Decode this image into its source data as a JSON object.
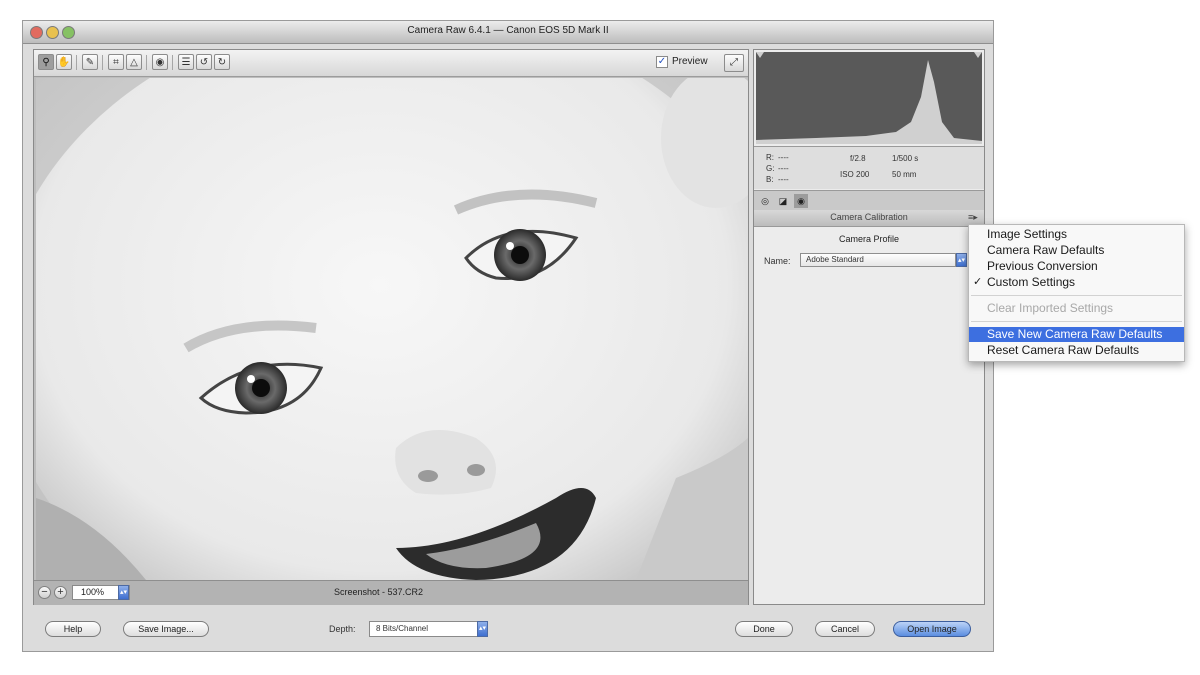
{
  "window": {
    "title": "Camera Raw 6.4.1  —  Canon EOS 5D Mark II"
  },
  "toolbar": {
    "tools": [
      "zoom-icon",
      "hand-icon",
      "eyedropper-icon",
      "crop-icon",
      "straighten-icon",
      "redeye-icon",
      "preferences-icon",
      "rotate-left-icon",
      "rotate-right-icon"
    ],
    "preview_label": "Preview",
    "preview_checked": "✓"
  },
  "status": {
    "zoom_value": "100%",
    "filename": "Screenshot - 537.CR2"
  },
  "exif": {
    "r_label": "R:",
    "g_label": "G:",
    "b_label": "B:",
    "dash": "----",
    "aperture": "f/2.8",
    "shutter": "1/500 s",
    "iso": "ISO 200",
    "focal": "50 mm"
  },
  "panel": {
    "section_title": "Camera Calibration",
    "profile_heading": "Camera Profile",
    "name_label": "Name:",
    "name_value": "Adobe Standard"
  },
  "bottom": {
    "help": "Help",
    "save_image": "Save Image...",
    "depth_label": "Depth:",
    "depth_value": "8 Bits/Channel",
    "done": "Done",
    "cancel": "Cancel",
    "open_image": "Open Image"
  },
  "menu": {
    "items": [
      {
        "label": "Image Settings"
      },
      {
        "label": "Camera Raw Defaults"
      },
      {
        "label": "Previous Conversion"
      },
      {
        "label": "Custom Settings",
        "checked": "✓"
      },
      {
        "label": "Clear Imported Settings"
      },
      {
        "label": "Save New Camera Raw Defaults"
      },
      {
        "label": "Reset Camera Raw Defaults"
      }
    ]
  },
  "colors": {
    "accent": "#3d6fe0",
    "window_bg": "#dcdcdc"
  }
}
